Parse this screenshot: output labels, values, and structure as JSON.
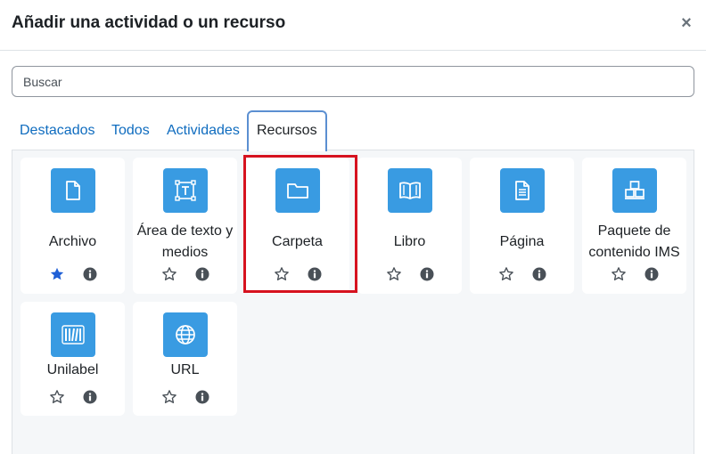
{
  "modal": {
    "title": "Añadir una actividad o un recurso",
    "close_symbol": "×"
  },
  "search": {
    "placeholder": "Buscar",
    "value": ""
  },
  "tabs": [
    {
      "label": "Destacados",
      "active": false
    },
    {
      "label": "Todos",
      "active": false
    },
    {
      "label": "Actividades",
      "active": false
    },
    {
      "label": "Recursos",
      "active": true
    }
  ],
  "modules": [
    {
      "name": "Archivo",
      "icon": "file-icon",
      "starred": true
    },
    {
      "name": "Área de texto y medios",
      "icon": "text-area-icon",
      "starred": false
    },
    {
      "name": "Carpeta",
      "icon": "folder-icon",
      "starred": false
    },
    {
      "name": "Libro",
      "icon": "book-icon",
      "starred": false
    },
    {
      "name": "Página",
      "icon": "page-icon",
      "starred": false
    },
    {
      "name": "Paquete de contenido IMS",
      "icon": "package-icon",
      "starred": false
    },
    {
      "name": "Unilabel",
      "icon": "unilabel-icon",
      "starred": false
    },
    {
      "name": "URL",
      "icon": "globe-icon",
      "starred": false
    }
  ],
  "colors": {
    "accent": "#399be2",
    "link": "#0f6cbf",
    "star_active": "#1f5fd6",
    "highlight": "#d6121f"
  }
}
